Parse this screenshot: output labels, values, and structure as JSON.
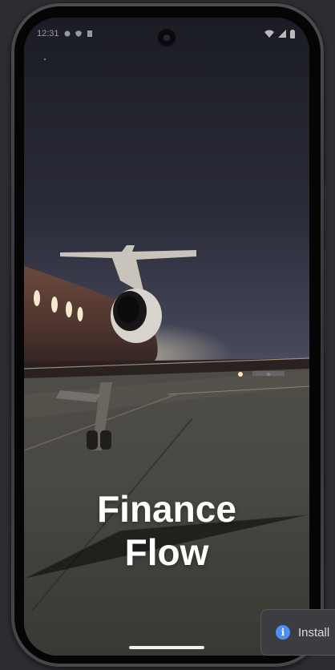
{
  "device": {
    "status_time": "12:31"
  },
  "splash": {
    "title_line1": "Finance",
    "title_line2": "Flow",
    "background": "night-airport-private-jet"
  },
  "notification": {
    "icon": "info-icon",
    "text": "Install"
  },
  "colors": {
    "accent": "#4d8ef7",
    "title": "#ffffff",
    "frame": "#3a3c40"
  }
}
